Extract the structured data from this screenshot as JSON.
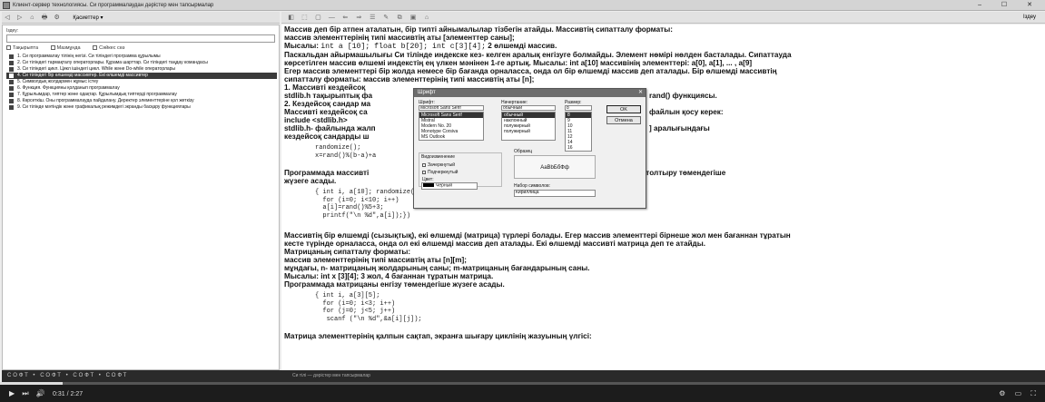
{
  "window": {
    "title": "Клиент-сервер технологиясы. Си программалаудан дәрістер мен тапсырмалар",
    "controls": "‒ ☐ ✕"
  },
  "left_toolbar": {
    "icons": [
      "◁",
      "▷",
      "⌂",
      "🖶",
      "⚙"
    ],
    "dropdown_label": "Қасиеттер ▾"
  },
  "left_pane": {
    "search_label": "Іздеу:",
    "search_value": "",
    "checkboxes": [
      "Тақырыпта",
      "Мазмұнда",
      "Сәйкес сөз"
    ],
    "topics": [
      {
        "label": "1. Си программалау тілінің негізі. Си тіліндегі программа құрылымы",
        "selected": false
      },
      {
        "label": "2. Си тіліндегі тармақталу операторлары. Құрама шарттар. Си тіліндегі таңдау командасы",
        "selected": false
      },
      {
        "label": "3. Си тіліндегі цикл. Цикл ішіндегі цикл. While және Do-while операторлары",
        "selected": false
      },
      {
        "label": "4. Си тіліндегі бір өлшемді массивтер. Екі өлшемді массивтер",
        "selected": true
      },
      {
        "label": "5. Символдық жолдармен жұмыс істеу",
        "selected": false
      },
      {
        "label": "6. Функция. Функцияны қолданып программалау",
        "selected": false
      },
      {
        "label": "7. Құрылымдар, типтер және одақтар. Құрылымдық типтерді программалау",
        "selected": false
      },
      {
        "label": "8. Көрсеткіш. Оны программалауда пайдалану. Деректер элементтеріне қол жеткізу",
        "selected": false
      },
      {
        "label": "9. Си тілінде мәтіндік және графикалық режимдегі экранды басқару функциялары",
        "selected": false
      }
    ]
  },
  "right_toolbar": {
    "icons": [
      "◧",
      "⬚",
      "▢",
      "—",
      "⇐",
      "⇒",
      "☰",
      "✎",
      "⧉",
      "▣",
      "⌂"
    ],
    "right_text": "Іздеу"
  },
  "content": {
    "lines_top": [
      "Массив деп бір атпен аталатын, бір типті айнымалылар тізбегін атайды. Массивтің сипатталу форматы:",
      "массив элементтерінің типі массивтің аты [элементтер саны];"
    ],
    "example1_prefix": "Мысалы: ",
    "example1_code": "int a [10]; float b[20]; int c[3][4];",
    "example1_suffix": " 2 өлшемді массив.",
    "lines_mid": [
      "Паскальдан айырмашылығы Си тілінде индекске кез- келген аралық енгізуге болмайды. Элемент нөмірі нөлден басталады. Сипаттауда",
      "көрсетілген массив өлшемі индекстің ең үлкен мәнінен 1-ге артық. Мысалы: int a[10] массивінің элементтері: a[0], a[1], ... , a[9]",
      "Егер массив элементтері бір жолда немесе бір бағанда орналасса, онда ол бір өлшемді массив деп аталады. Бір өлшемді массивтің",
      "сипатталу форматы: массив элементтерінің типі массивтің аты [n];",
      "1. Массивті кездейсоқ",
      "stdlib.h тақырыптық фа",
      "2. Кездейсоқ сандар ма",
      "Массивті кездейсоқ са",
      "include <stdlib.h>",
      "stdlib.h- файлында жалп",
      "кездейсоқ сандарды ш"
    ],
    "lines_mid_right": [
      "",
      "",
      "",
      "",
      "",
      "rand() функциясы.",
      "",
      "файлын қосу керек:",
      "",
      "] аралығындағы",
      ""
    ],
    "code1": "randomize();\nx=rand()%(b-a)+a",
    "fill_line_left": "Программада массивті",
    "fill_line_right": "толтыру төмендегіше",
    "fill_line2": "жүзеге асады.",
    "code2": "{ int i, a[10]; randomize();\n  for (i=0; i<10; i++)\n  a[i]=rand()%5+3;\n  printf(\"\\n %d\",a[i]);})",
    "lines_bottom": [
      "Массивтің бір өлшемді (сызықтық), екі өлшемді (матрица) түрлері болады. Егер массив элементтері бірнеше жол мен бағаннан тұратын",
      "кесте түрінде орналасса, онда ол екі өлшемді массив деп аталады. Екі өлшемді массивті матрица деп те атайды.",
      "Матрицаның сипатталу форматы:",
      "массив элементтерінің типі массивтің аты [n][m];",
      "мұндағы, n- матрицаның жолдарының саны; m-матрицаның бағандарының саны.",
      "Мысалы: int x [3][4]; 3 жол, 4 бағаннан тұратын матрица.",
      "Программада матрицаны енгізу төмендегіше жүзеге асады."
    ],
    "code3": "{ int i, a[3][5];\n  for (i=0; i<3; i++)\n  for (j=0; j<5; j++)\n   scanf (\"\\n %d\",&a[i][j]);",
    "last_line": "Матрица элементтерінің қалпын сақтап, экранға шығару циклінің жазуының үлгісі:"
  },
  "font_dialog": {
    "title": "Шрифт",
    "close": "✕",
    "font_label": "Шрифт:",
    "font_value": "Microsoft Sans Serif",
    "fonts": [
      "Microsoft Sans Serif",
      "Mistral",
      "Modern No. 20",
      "Monotype Corsiva",
      "MS Outlook"
    ],
    "style_label": "Начертание:",
    "style_value": "обычный",
    "styles": [
      "обычный",
      "наклонный",
      "полужирный",
      "полужирный"
    ],
    "size_label": "Размер:",
    "size_value": "8",
    "sizes": [
      "8",
      "9",
      "10",
      "11",
      "12",
      "14",
      "16"
    ],
    "ok": "OK",
    "cancel": "Отмена",
    "effects_label": "Видоизменение",
    "strike": "Зачеркнутый",
    "underline": "Подчеркнутый",
    "color_label": "Цвет:",
    "color_value": "Черный",
    "sample_label": "Образец",
    "sample_text": "AaBbБбФф",
    "charset_label": "Набор символов:",
    "charset_value": "Кириллица"
  },
  "thumb_strip": {
    "text": "СОФТ • СОФТ • СОФТ • СОФТ",
    "sub": "Си тілі — дәрістер мен тапсырмалар"
  },
  "player": {
    "progress": 0.06,
    "time": "0:31 / 2:27",
    "left_icons": [
      "▶",
      "⏭",
      "🔊"
    ],
    "right_icons": [
      "⚙",
      "▭",
      "⛶"
    ]
  },
  "colors": {
    "content_bg": "#ffffff",
    "player_bg": "#1c1c1c",
    "selection": "#3a3a3a"
  }
}
